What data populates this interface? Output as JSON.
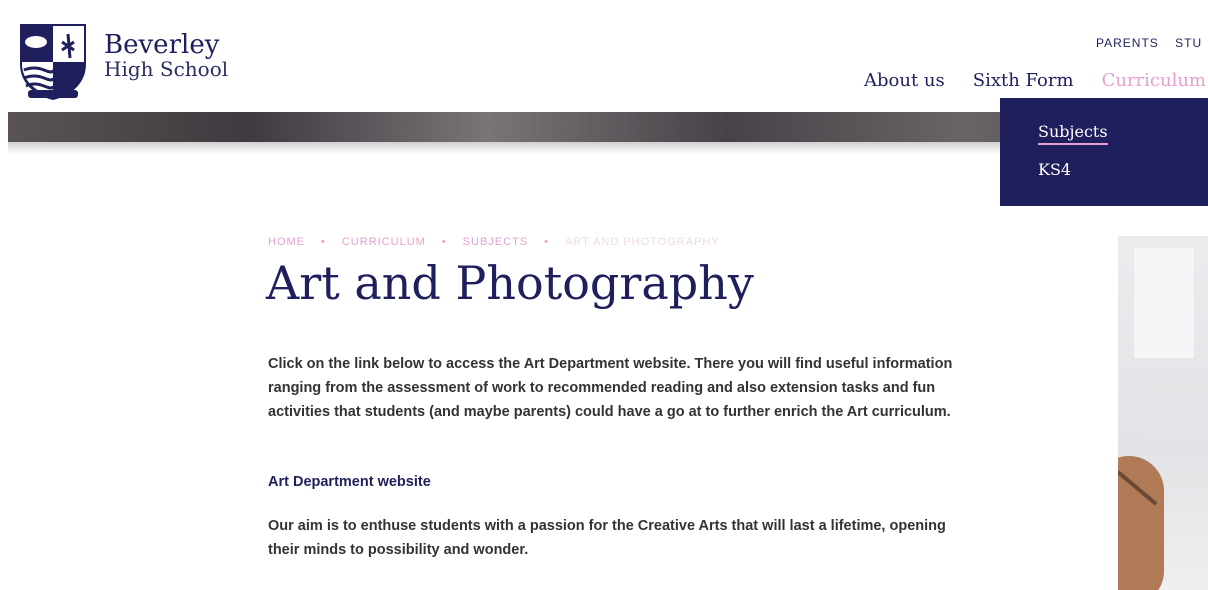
{
  "header": {
    "school_name_line1": "Beverley",
    "school_name_line2": "High School",
    "top_links": [
      "PARENTS",
      "STU"
    ],
    "main_nav": [
      {
        "label": "About us"
      },
      {
        "label": "Sixth Form"
      },
      {
        "label": "Curriculum",
        "active": true
      }
    ]
  },
  "dropdown": {
    "items": [
      "Subjects",
      "KS4"
    ]
  },
  "breadcrumb": {
    "items": [
      "HOME",
      "CURRICULUM",
      "SUBJECTS",
      "ART AND PHOTOGRAPHY"
    ],
    "separator": "•"
  },
  "page": {
    "title": "Art and Photography",
    "intro": "Click on the link below to access the Art Department website. There you will find useful information ranging from the assessment of work to recommended reading and also extension tasks and fun activities that students (and maybe parents) could have a go at to further enrich the Art curriculum.",
    "link_label": "Art Department website",
    "aim": "Our aim is to enthuse students with a passion for the Creative Arts that will last a lifetime, opening their minds to possibility and wonder."
  },
  "colors": {
    "brand_navy": "#1e1f5c",
    "accent_pink": "#e6a0cf"
  }
}
